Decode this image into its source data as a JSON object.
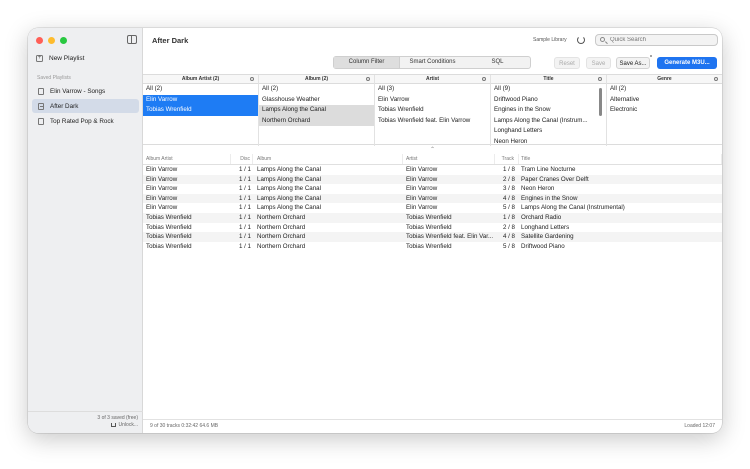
{
  "sidebar": {
    "new_playlist": "New Playlist",
    "saved_heading": "Saved Playlists",
    "playlists": [
      {
        "label": "Elin Varrow - Songs"
      },
      {
        "label": "After Dark"
      },
      {
        "label": "Top Rated Pop & Rock"
      }
    ],
    "saved_count": "3 of 3 saved (free)",
    "unlock": "Unlock..."
  },
  "header": {
    "title": "After Dark",
    "library_label": "Sample Library",
    "search_placeholder": "Quick Search"
  },
  "modes": {
    "column_filter": "Column Filter",
    "smart_conditions": "Smart Conditions",
    "sql": "SQL"
  },
  "toolbar": {
    "reset": "Reset",
    "save": "Save",
    "save_as": "Save As...",
    "generate": "Generate M3U..."
  },
  "browser": {
    "album_artist": {
      "header": "Album Artist (2)",
      "items": [
        "All (2)",
        "Elin Varrow",
        "Tobias Wrenfield"
      ]
    },
    "album": {
      "header": "Album (2)",
      "items": [
        "All (2)",
        "Glasshouse Weather",
        "Lamps Along the Canal",
        "Northern Orchard"
      ]
    },
    "artist": {
      "header": "Artist",
      "items": [
        "All (3)",
        "Elin Varrow",
        "Tobias Wrenfield",
        "Tobias Wrenfield feat. Elin Varrow"
      ]
    },
    "title": {
      "header": "Title",
      "items": [
        "All (9)",
        "Driftwood Piano",
        "Engines in the Snow",
        "Lamps Along the Canal (Instrum...",
        "Longhand Letters",
        "Neon Heron"
      ]
    },
    "genre": {
      "header": "Genre",
      "items": [
        "All (2)",
        "Alternative",
        "Electronic"
      ]
    }
  },
  "tracks": {
    "headers": {
      "album_artist": "Album Artist",
      "disc": "Disc",
      "album": "Album",
      "artist": "Artist",
      "track": "Track",
      "title": "Title"
    },
    "rows": [
      {
        "album_artist": "Elin Varrow",
        "disc": "1 / 1",
        "album": "Lamps Along the Canal",
        "artist": "Elin Varrow",
        "track": "1 / 8",
        "title": "Tram Line Nocturne"
      },
      {
        "album_artist": "Elin Varrow",
        "disc": "1 / 1",
        "album": "Lamps Along the Canal",
        "artist": "Elin Varrow",
        "track": "2 / 8",
        "title": "Paper Cranes Over Delft"
      },
      {
        "album_artist": "Elin Varrow",
        "disc": "1 / 1",
        "album": "Lamps Along the Canal",
        "artist": "Elin Varrow",
        "track": "3 / 8",
        "title": "Neon Heron"
      },
      {
        "album_artist": "Elin Varrow",
        "disc": "1 / 1",
        "album": "Lamps Along the Canal",
        "artist": "Elin Varrow",
        "track": "4 / 8",
        "title": "Engines in the Snow"
      },
      {
        "album_artist": "Elin Varrow",
        "disc": "1 / 1",
        "album": "Lamps Along the Canal",
        "artist": "Elin Varrow",
        "track": "5 / 8",
        "title": "Lamps Along the Canal (Instrumental)"
      },
      {
        "album_artist": "Tobias Wrenfield",
        "disc": "1 / 1",
        "album": "Northern Orchard",
        "artist": "Tobias Wrenfield",
        "track": "1 / 8",
        "title": "Orchard Radio"
      },
      {
        "album_artist": "Tobias Wrenfield",
        "disc": "1 / 1",
        "album": "Northern Orchard",
        "artist": "Tobias Wrenfield",
        "track": "2 / 8",
        "title": "Longhand Letters"
      },
      {
        "album_artist": "Tobias Wrenfield",
        "disc": "1 / 1",
        "album": "Northern Orchard",
        "artist": "Tobias Wrenfield feat. Elin Var...",
        "track": "4 / 8",
        "title": "Satellite Gardening"
      },
      {
        "album_artist": "Tobias Wrenfield",
        "disc": "1 / 1",
        "album": "Northern Orchard",
        "artist": "Tobias Wrenfield",
        "track": "5 / 8",
        "title": "Driftwood Piano"
      }
    ]
  },
  "status": {
    "summary": "9 of 30 tracks   0:32:42   64.6 MB",
    "loaded": "Loaded 12:07"
  },
  "colors": {
    "accent": "#1e7cf4",
    "selection_gray": "#dcdcdc",
    "sidebar_selected": "#d3dbe8"
  }
}
